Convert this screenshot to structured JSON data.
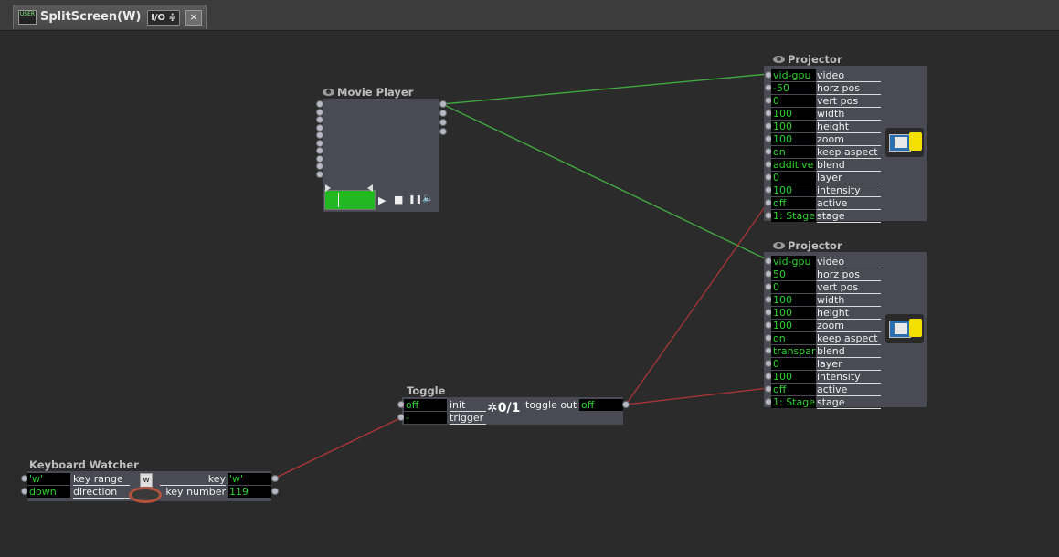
{
  "tab": {
    "icon_text": "USER",
    "title": "SplitScreen(W)",
    "io_label": "I/O ≑",
    "close_label": "×"
  },
  "movie_player": {
    "title": "Movie Player",
    "controls": {
      "play": "▶",
      "stop": "■",
      "pause": "❚❚",
      "volume": "🔈"
    },
    "progress_color": "#22b822"
  },
  "projector1": {
    "title": "Projector",
    "rows": [
      {
        "value": "vid-gpu",
        "label": "video"
      },
      {
        "value": "-50",
        "label": "horz pos"
      },
      {
        "value": "0",
        "label": "vert pos"
      },
      {
        "value": "100",
        "label": "width"
      },
      {
        "value": "100",
        "label": "height"
      },
      {
        "value": "100",
        "label": "zoom"
      },
      {
        "value": "on",
        "label": "keep aspect"
      },
      {
        "value": "additive",
        "label": "blend"
      },
      {
        "value": "0",
        "label": "layer"
      },
      {
        "value": "100",
        "label": "intensity"
      },
      {
        "value": "off",
        "label": "active"
      },
      {
        "value": "1: Stage",
        "label": "stage"
      }
    ]
  },
  "projector2": {
    "title": "Projector",
    "rows": [
      {
        "value": "vid-gpu",
        "label": "video"
      },
      {
        "value": "50",
        "label": "horz pos"
      },
      {
        "value": "0",
        "label": "vert pos"
      },
      {
        "value": "100",
        "label": "width"
      },
      {
        "value": "100",
        "label": "height"
      },
      {
        "value": "100",
        "label": "zoom"
      },
      {
        "value": "on",
        "label": "keep aspect"
      },
      {
        "value": "transparent",
        "label": "blend"
      },
      {
        "value": "0",
        "label": "layer"
      },
      {
        "value": "100",
        "label": "intensity"
      },
      {
        "value": "off",
        "label": "active"
      },
      {
        "value": "1: Stage",
        "label": "stage"
      }
    ]
  },
  "toggle": {
    "title": "Toggle",
    "init_value": "off",
    "init_label": "init",
    "trigger_value": "-",
    "trigger_label": "trigger",
    "icon_text": "✲0/1",
    "out_label": "toggle out",
    "out_value": "off"
  },
  "keyboard": {
    "title": "Keyboard Watcher",
    "key_range_value": "'w'",
    "key_range_label": "key range",
    "direction_value": "down",
    "direction_label": "direction",
    "icon_key": "w",
    "key_label": "key",
    "key_value": "'w'",
    "key_number_label": "key number",
    "key_number_value": "119"
  },
  "colors": {
    "background": "#2b2b2b",
    "value_text": "#2fd12f",
    "wire_video": "#3fa83f",
    "wire_control": "#b03636"
  }
}
